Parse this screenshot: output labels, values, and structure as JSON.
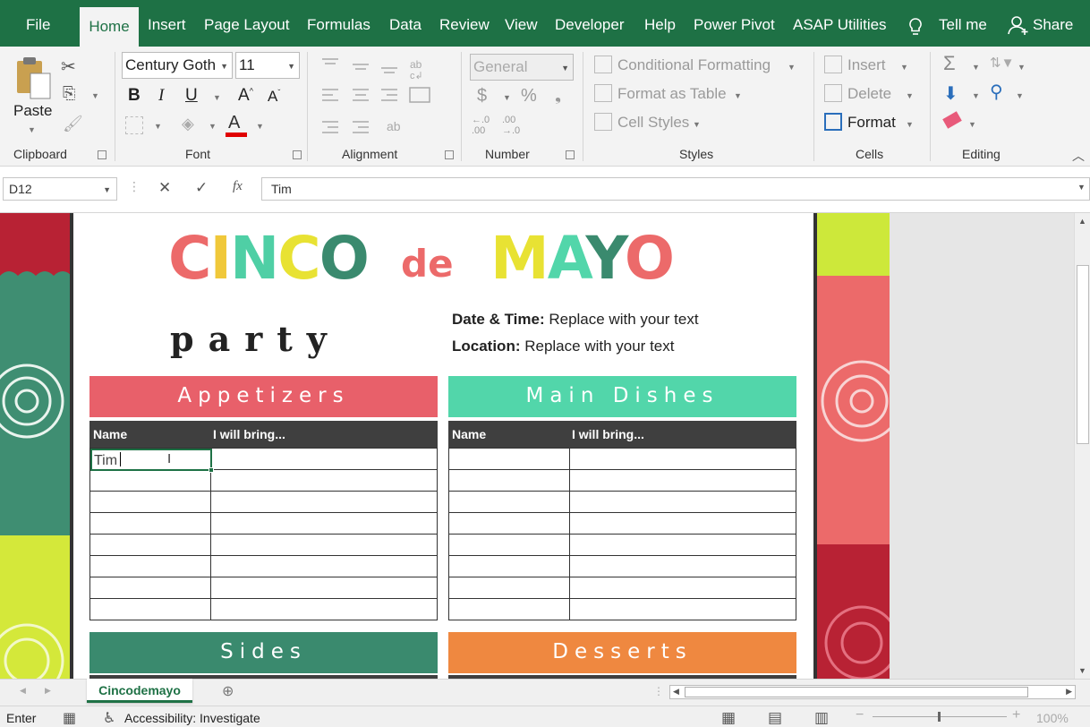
{
  "tabs": {
    "file": "File",
    "home": "Home",
    "insert": "Insert",
    "page_layout": "Page Layout",
    "formulas": "Formulas",
    "data": "Data",
    "review": "Review",
    "view": "View",
    "developer": "Developer",
    "help": "Help",
    "power_pivot": "Power Pivot",
    "asap": "ASAP Utilities",
    "tell_me": "Tell me",
    "share": "Share"
  },
  "ribbon": {
    "clipboard": {
      "paste": "Paste",
      "label": "Clipboard"
    },
    "font": {
      "family": "Century Goth",
      "size": "11",
      "label": "Font"
    },
    "alignment": {
      "label": "Alignment"
    },
    "number": {
      "format": "General",
      "label": "Number",
      "dec_inc": "←.0 .00",
      "dec_dec": ".00 →.0"
    },
    "styles": {
      "conditional": "Conditional Formatting",
      "format_table": "Format as Table",
      "cell_styles": "Cell Styles",
      "label": "Styles"
    },
    "cells": {
      "insert": "Insert",
      "delete": "Delete",
      "format": "Format",
      "label": "Cells"
    },
    "editing": {
      "label": "Editing"
    }
  },
  "formula_bar": {
    "name_box": "D12",
    "fx": "fx",
    "value": "Tim"
  },
  "flyer": {
    "title_cinco": "CINCO",
    "title_de": "de",
    "title_mayo": "MAYO",
    "party": "party",
    "date_label": "Date & Time:",
    "date_value": " Replace with your text",
    "location_label": "Location:",
    "location_value": " Replace with your text",
    "col_name": "Name",
    "col_bring": "I will bring...",
    "editing_cell_value": "Tim",
    "categories": [
      {
        "label": "Appetizers",
        "color": "#e8606a"
      },
      {
        "label": "Main Dishes",
        "color": "#52d6aa"
      },
      {
        "label": "Sides",
        "color": "#3a8a6e"
      },
      {
        "label": "Desserts",
        "color": "#ef8840"
      }
    ],
    "title_colors": [
      "#ec6a6a",
      "#f0c83a",
      "#4fcfa5",
      "#e8e233",
      "#3a8a6e",
      "#ef8840"
    ]
  },
  "sheet_tab": "Cincodemayo",
  "status": {
    "mode": "Enter",
    "accessibility": "Accessibility: Investigate",
    "zoom": "100%"
  }
}
